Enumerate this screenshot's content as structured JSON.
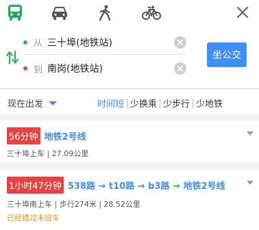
{
  "header": {
    "modes": [
      {
        "icon": "bus-icon",
        "label": "",
        "active": true
      },
      {
        "icon": "car-icon",
        "label": "",
        "active": false
      },
      {
        "icon": "walk-icon",
        "label": "",
        "active": false
      },
      {
        "icon": "bike-icon",
        "label": "",
        "active": false
      }
    ],
    "close_icon": "close-icon"
  },
  "route": {
    "from_tag": "从",
    "from_place": "三十埠(地铁站)",
    "to_tag": "到",
    "to_place": "南岗(地铁站)",
    "go_label": "坐公交",
    "colors": {
      "from_dot": "#2cb24c",
      "to_dot": "#e8473a",
      "accent": "#3d8ff7"
    }
  },
  "filters": {
    "depart_label": "现在出发",
    "sort_options": [
      "时间短",
      "少换乘",
      "少步行",
      "少地铁"
    ],
    "active_sort": "时间短"
  },
  "results": [
    {
      "duration": "56分钟",
      "lines": "地铁2号线",
      "meta": "三十埠上车 | 27.09公里",
      "warning": ""
    },
    {
      "duration": "1小时47分钟",
      "lines": "538路 → t10路 → b3路 → 地铁2号线",
      "meta": "三十埠南上车 | 步行274米 | 28.52公里",
      "warning": "已经错过末班车"
    }
  ]
}
